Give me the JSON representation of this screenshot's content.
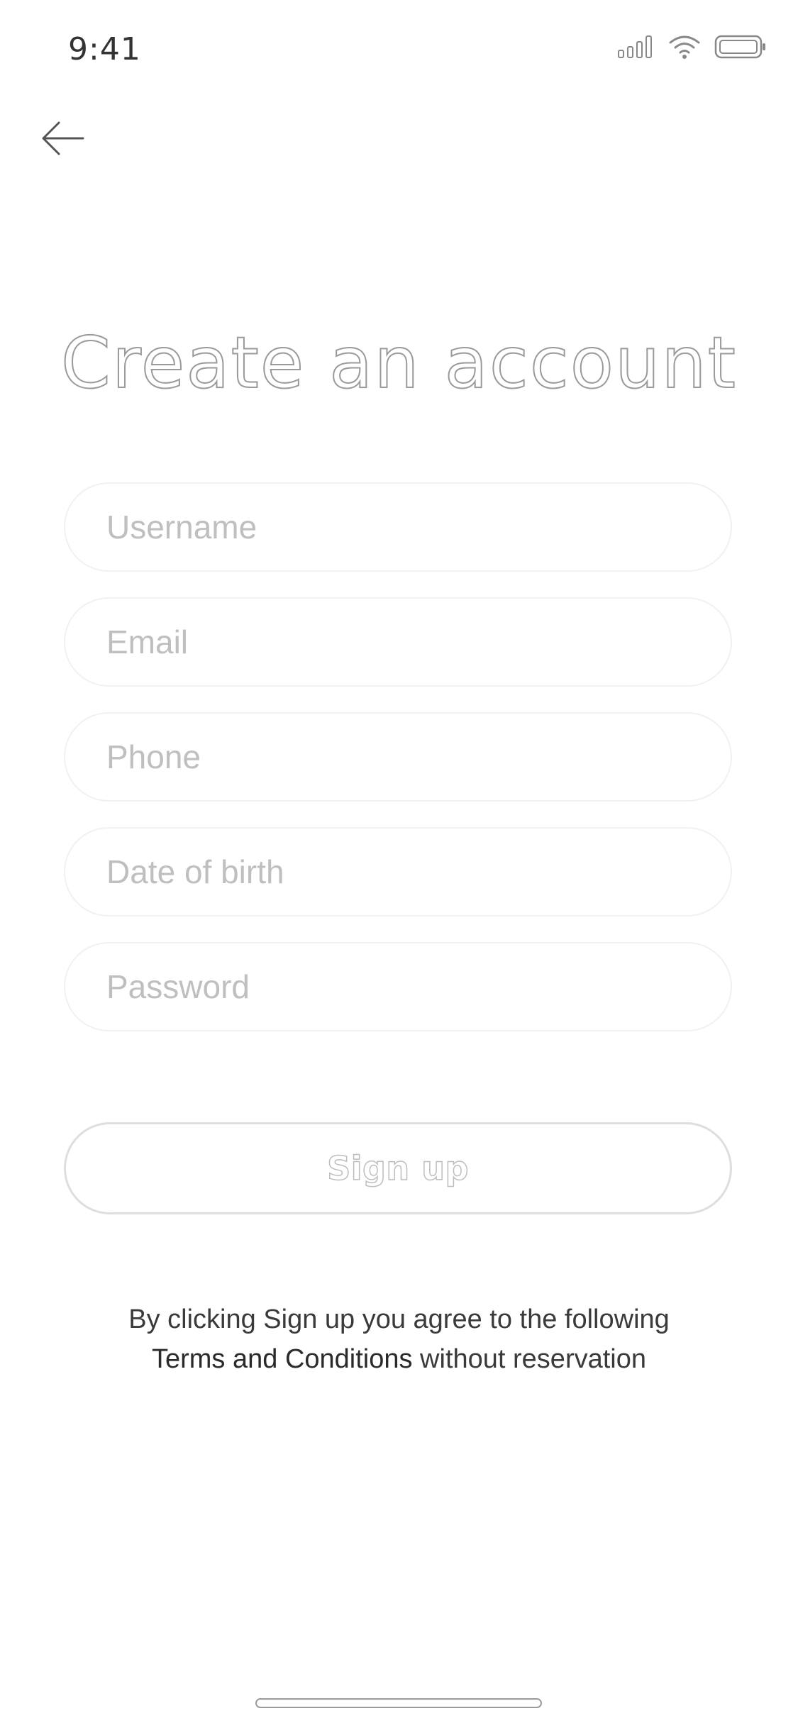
{
  "status_bar": {
    "time": "9:41",
    "icons": [
      "signal-icon",
      "wifi-icon",
      "battery-icon"
    ]
  },
  "nav": {
    "back_icon": "arrow-left-icon"
  },
  "title": "Create an account",
  "form": {
    "username": {
      "placeholder": "Username",
      "value": ""
    },
    "email": {
      "placeholder": "Email",
      "value": ""
    },
    "phone": {
      "placeholder": "Phone",
      "value": ""
    },
    "dob": {
      "placeholder": "Date of birth",
      "value": ""
    },
    "password": {
      "placeholder": "Password",
      "value": ""
    }
  },
  "signup_button": {
    "label": "Sign up"
  },
  "terms": {
    "line1": "By clicking Sign up you agree to the following",
    "link": "Terms and Conditions",
    "line2_rest": " without reservation"
  },
  "colors": {
    "background": "#ffffff",
    "field_border": "#f1f1f1",
    "placeholder": "#bfbfbf",
    "outline_text": "#9a9a9a"
  }
}
